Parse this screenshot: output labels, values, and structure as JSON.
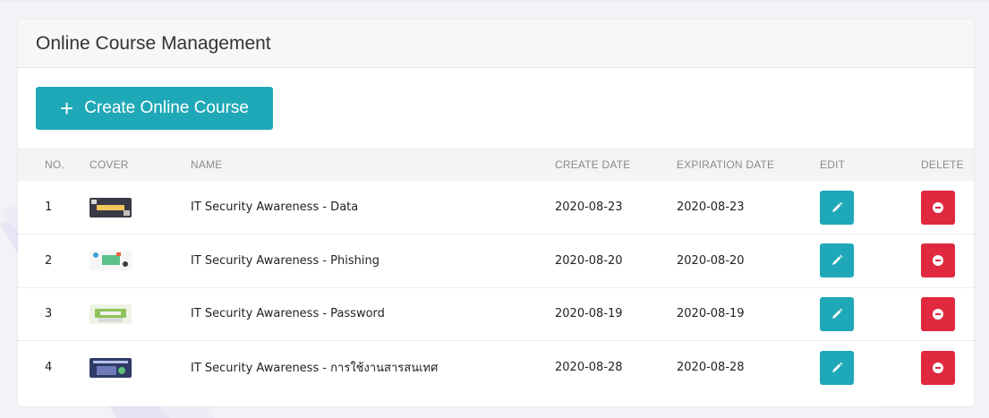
{
  "page": {
    "title": "Online Course Management",
    "create_button_label": "Create Online Course",
    "create_button_icon": "plus-icon"
  },
  "colors": {
    "accent": "#1fa8b7",
    "danger": "#e0283f"
  },
  "table": {
    "headers": {
      "no": "NO.",
      "cover": "COVER",
      "name": "NAME",
      "create_date": "CREATE DATE",
      "expiration_date": "EXPIRATION DATE",
      "edit": "EDIT",
      "delete": "DELETE"
    },
    "rows": [
      {
        "no": "1",
        "cover": "course-cover-data",
        "name": "IT Security Awareness - Data",
        "create_date": "2020-08-23",
        "expiration_date": "2020-08-23"
      },
      {
        "no": "2",
        "cover": "course-cover-phishing",
        "name": "IT Security Awareness - Phishing",
        "create_date": "2020-08-20",
        "expiration_date": "2020-08-20"
      },
      {
        "no": "3",
        "cover": "course-cover-password",
        "name": "IT Security Awareness - Password",
        "create_date": "2020-08-19",
        "expiration_date": "2020-08-19"
      },
      {
        "no": "4",
        "cover": "course-cover-information",
        "name": "IT Security Awareness - การใช้งานสารสนเทศ",
        "create_date": "2020-08-28",
        "expiration_date": "2020-08-28"
      }
    ]
  }
}
